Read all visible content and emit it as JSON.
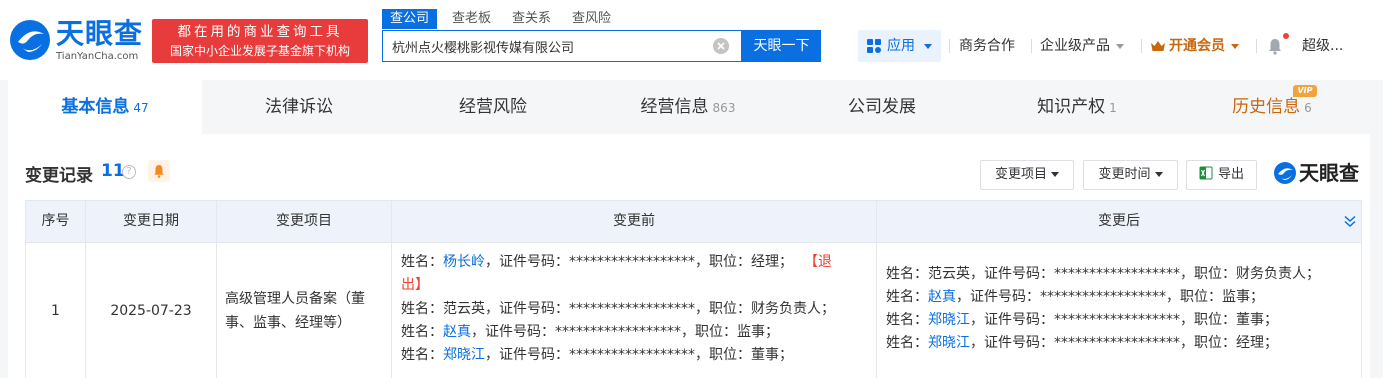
{
  "brand": {
    "logo_text": "天眼查",
    "logo_sub": "TianYanCha.com",
    "promo_line1": "都在用的商业查询工具",
    "promo_line2": "国家中小企业发展子基金旗下机构"
  },
  "search": {
    "tabs": [
      "查公司",
      "查老板",
      "查关系",
      "查风险"
    ],
    "value": "杭州点火樱桃影视传媒有限公司",
    "button": "天眼一下"
  },
  "nav": {
    "apps": "应用",
    "business": "商务合作",
    "enterprise": "企业级产品",
    "vip": "开通会员",
    "user": "超级..."
  },
  "tabs": [
    {
      "label": "基本信息",
      "count": "47"
    },
    {
      "label": "法律诉讼",
      "count": ""
    },
    {
      "label": "经营风险",
      "count": ""
    },
    {
      "label": "经营信息",
      "count": "863"
    },
    {
      "label": "公司发展",
      "count": ""
    },
    {
      "label": "知识产权",
      "count": "1"
    },
    {
      "label": "历史信息",
      "count": "6"
    }
  ],
  "vip_badge": "VIP",
  "section": {
    "title": "变更记录",
    "count": "11",
    "help": "?",
    "filter_item": "变更项目",
    "filter_time": "变更时间",
    "export": "导出",
    "watermark": "天眼查"
  },
  "table": {
    "headers": [
      "序号",
      "变更日期",
      "变更项目",
      "变更前",
      "变更后"
    ],
    "rows": [
      {
        "index": "1",
        "date": "2025-07-23",
        "item": "高级管理人员备案（董事、监事、经理等）",
        "before": [
          {
            "prefix": "姓名：",
            "name": "杨长岭",
            "suffix": "，证件号码：******************，职位：经理；",
            "tag": "【退"
          },
          {
            "prefix": "",
            "name": "",
            "suffix": "",
            "tag": "出】"
          },
          {
            "prefix": "姓名：范云英，证件号码：******************，职位：财务负责人；",
            "name": "",
            "suffix": "",
            "tag": ""
          },
          {
            "prefix": "姓名：",
            "name": "赵真",
            "suffix": "，证件号码：******************，职位：监事；",
            "tag": ""
          },
          {
            "prefix": "姓名：",
            "name": "郑晓江",
            "suffix": "，证件号码：******************，职位：董事；",
            "tag": ""
          }
        ],
        "after": [
          {
            "prefix": "姓名：范云英，证件号码：******************，职位：财务负责人；",
            "name": "",
            "suffix": ""
          },
          {
            "prefix": "姓名：",
            "name": "赵真",
            "suffix": "，证件号码：******************，职位：监事；"
          },
          {
            "prefix": "姓名：",
            "name": "郑晓江",
            "suffix": "，证件号码：******************，职位：董事；"
          },
          {
            "prefix": "姓名：",
            "name": "郑晓江",
            "suffix": "，证件号码：******************，职位：经理；"
          }
        ]
      }
    ]
  },
  "colors": {
    "brand_blue": "#0a6fe0",
    "promo_red": "#e83c3c",
    "vip_orange": "#c8670b",
    "exit_red": "#f04134"
  }
}
